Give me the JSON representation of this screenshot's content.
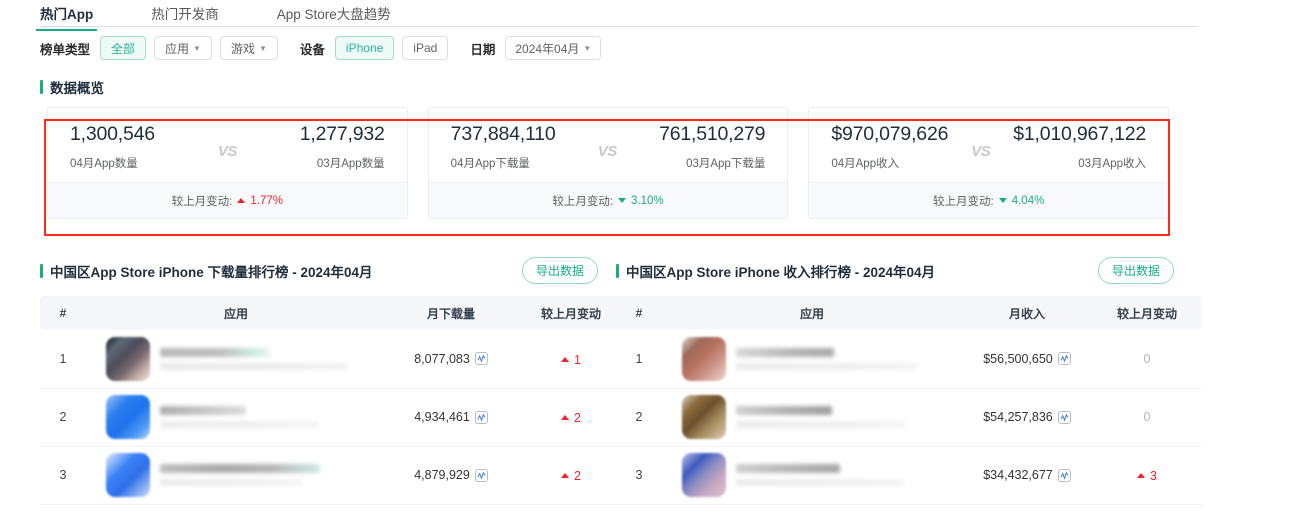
{
  "tabs": [
    {
      "label": "热门App",
      "active": true
    },
    {
      "label": "热门开发商",
      "active": false
    },
    {
      "label": "App Store大盘趋势",
      "active": false
    }
  ],
  "filters": {
    "rank_type_label": "榜单类型",
    "rank_type_options": [
      {
        "label": "全部",
        "selected": true,
        "caret": false
      },
      {
        "label": "应用",
        "selected": false,
        "caret": true
      },
      {
        "label": "游戏",
        "selected": false,
        "caret": true
      }
    ],
    "device_label": "设备",
    "device_options": [
      {
        "label": "iPhone",
        "selected": true,
        "caret": false
      },
      {
        "label": "iPad",
        "selected": false,
        "caret": false
      }
    ],
    "date_label": "日期",
    "date_value": "2024年04月",
    "caret_glyph": "▼"
  },
  "overview": {
    "title": "数据概览",
    "vs_label": "VS",
    "change_label": "较上月变动:",
    "cards": [
      {
        "current_value": "1,300,546",
        "current_caption": "04月App数量",
        "previous_value": "1,277,932",
        "previous_caption": "03月App数量",
        "change_pct": "1.77%",
        "change_dir": "up"
      },
      {
        "current_value": "737,884,110",
        "current_caption": "04月App下载量",
        "previous_value": "761,510,279",
        "previous_caption": "03月App下载量",
        "change_pct": "3.10%",
        "change_dir": "down"
      },
      {
        "current_value": "$970,079,626",
        "current_caption": "04月App收入",
        "previous_value": "$1,010,967,122",
        "previous_caption": "03月App收入",
        "change_pct": "4.04%",
        "change_dir": "down"
      }
    ]
  },
  "tables": [
    {
      "title": "中国区App Store iPhone 下载量排行榜 - 2024年04月",
      "export_label": "导出数据",
      "columns": [
        "#",
        "应用",
        "月下载量",
        "较上月变动"
      ],
      "rows": [
        {
          "rank": "1",
          "app_name": "",
          "value": "8,077,083",
          "change": "1",
          "change_dir": "up"
        },
        {
          "rank": "2",
          "app_name": "",
          "value": "4,934,461",
          "change": "2",
          "change_dir": "up"
        },
        {
          "rank": "3",
          "app_name": "",
          "value": "4,879,929",
          "change": "2",
          "change_dir": "up"
        }
      ]
    },
    {
      "title": "中国区App Store iPhone 收入排行榜 - 2024年04月",
      "export_label": "导出数据",
      "columns": [
        "#",
        "应用",
        "月收入",
        "较上月变动"
      ],
      "rows": [
        {
          "rank": "1",
          "app_name": "",
          "value": "$56,500,650",
          "change": "0",
          "change_dir": "zero"
        },
        {
          "rank": "2",
          "app_name": "",
          "value": "$54,257,836",
          "change": "0",
          "change_dir": "zero"
        },
        {
          "rank": "3",
          "app_name": "",
          "value": "$34,432,677",
          "change": "3",
          "change_dir": "up"
        }
      ]
    }
  ],
  "colors": {
    "accent_teal": "#1aab8a",
    "up_red": "#f5222d",
    "down_green": "#1aab8a",
    "highlight_red": "#ff2b16",
    "header_bg": "#f5f7fa"
  }
}
